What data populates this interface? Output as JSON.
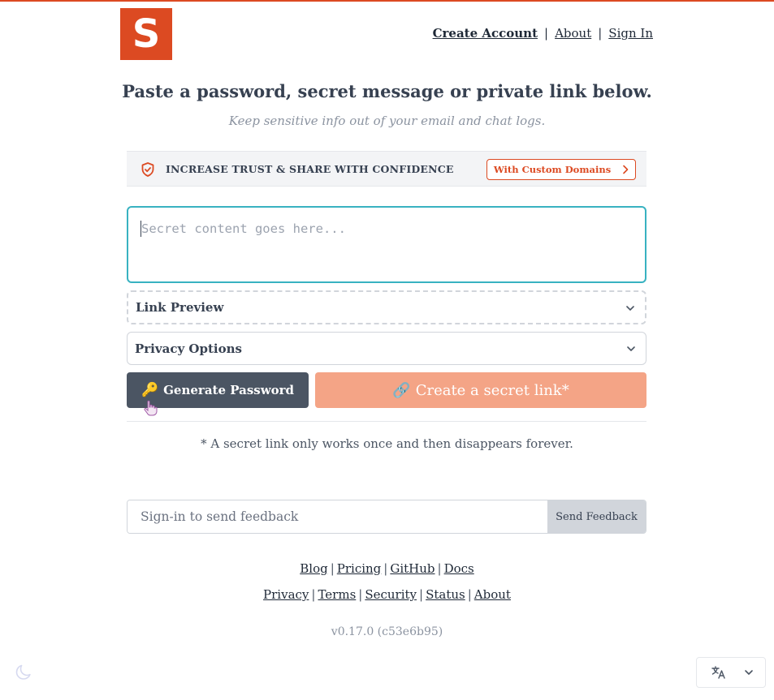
{
  "colors": {
    "brand": "#dc4a22",
    "focus": "#38b2c1",
    "create_button": "#f4a486",
    "generate_button": "#4b5563"
  },
  "logo": {
    "letter": "S"
  },
  "nav": {
    "create_account": "Create Account",
    "about": "About",
    "sign_in": "Sign In",
    "separator": "|"
  },
  "hero": {
    "title": "Paste a password, secret message or private link below.",
    "subtitle": "Keep sensitive info out of your email and chat logs."
  },
  "promo": {
    "icon": "shield-check-icon",
    "text": "INCREASE TRUST & SHARE WITH CONFIDENCE",
    "button_label": "With Custom Domains"
  },
  "secret": {
    "placeholder": "Secret content goes here..."
  },
  "link_preview": {
    "label": "Link Preview"
  },
  "privacy_options": {
    "label": "Privacy Options"
  },
  "actions": {
    "generate_label": "Generate Password",
    "generate_icon": "🔑",
    "create_label": "Create a secret link*",
    "create_icon": "🔗"
  },
  "footnote": "* A secret link only works once and then disappears forever.",
  "feedback": {
    "placeholder": "Sign-in to send feedback",
    "button_label": "Send Feedback"
  },
  "footer": {
    "row1": [
      "Blog",
      "Pricing",
      "GitHub",
      "Docs"
    ],
    "row2": [
      "Privacy",
      "Terms",
      "Security",
      "Status",
      "About"
    ],
    "version": "v0.17.0 (c53e6b95)"
  },
  "language": {
    "icon": "translate-icon"
  }
}
